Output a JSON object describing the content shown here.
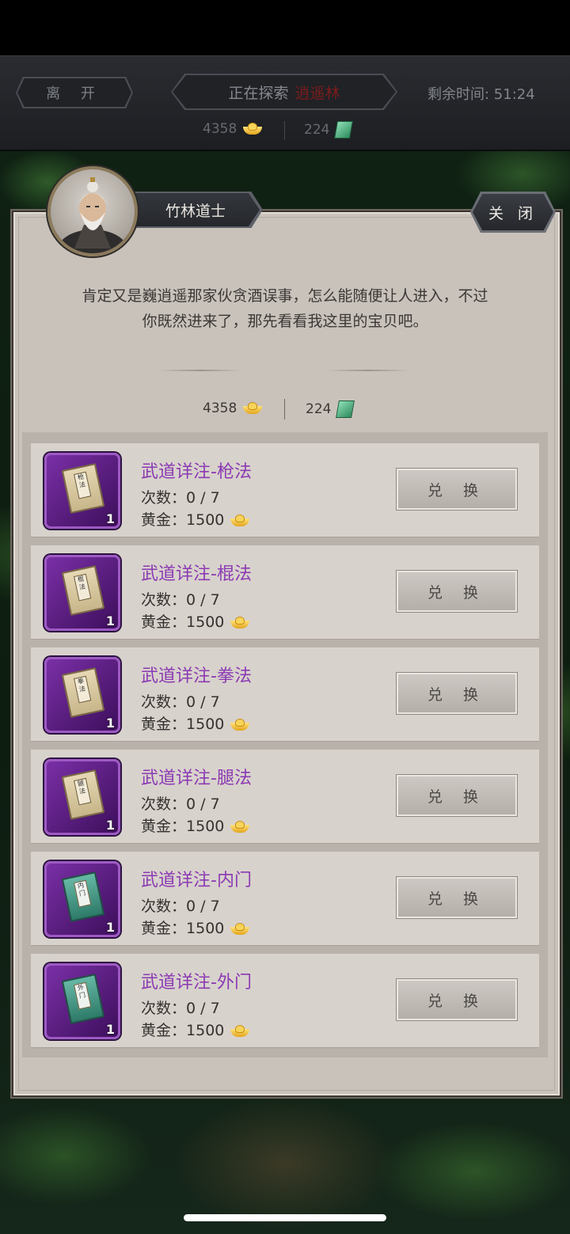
{
  "top_bar": {
    "leave_label": "离 开",
    "exploring_label": "正在探索",
    "location": "逍遥林",
    "timer": "剩余时间: 51:24",
    "gold": "4358",
    "jade": "224"
  },
  "npc": {
    "name": "竹林道士",
    "close_label": "关 闭",
    "dialog_line1": "肯定又是巍逍遥那家伙贪酒误事，怎么能随便让人进入，不过",
    "dialog_line2": "你既然进来了，那先看看我这里的宝贝吧。"
  },
  "currency": {
    "gold": "4358",
    "jade": "224"
  },
  "items": [
    {
      "name": "武道详注-枪法",
      "count": "次数：0 / 7",
      "price_label": "黄金：",
      "price": "1500",
      "qty": "1",
      "button": "兑 换",
      "book": "scroll",
      "book_text": "枪法"
    },
    {
      "name": "武道详注-棍法",
      "count": "次数：0 / 7",
      "price_label": "黄金：",
      "price": "1500",
      "qty": "1",
      "button": "兑 换",
      "book": "scroll",
      "book_text": "棍法"
    },
    {
      "name": "武道详注-拳法",
      "count": "次数：0 / 7",
      "price_label": "黄金：",
      "price": "1500",
      "qty": "1",
      "button": "兑 换",
      "book": "scroll",
      "book_text": "拳法"
    },
    {
      "name": "武道详注-腿法",
      "count": "次数：0 / 7",
      "price_label": "黄金：",
      "price": "1500",
      "qty": "1",
      "button": "兑 换",
      "book": "scroll",
      "book_text": "腿法"
    },
    {
      "name": "武道详注-内门",
      "count": "次数：0 / 7",
      "price_label": "黄金：",
      "price": "1500",
      "qty": "1",
      "button": "兑 换",
      "book": "teal",
      "book_text": "内门"
    },
    {
      "name": "武道详注-外门",
      "count": "次数：0 / 7",
      "price_label": "黄金：",
      "price": "1500",
      "qty": "1",
      "button": "兑 换",
      "book": "teal",
      "book_text": "外门"
    }
  ]
}
